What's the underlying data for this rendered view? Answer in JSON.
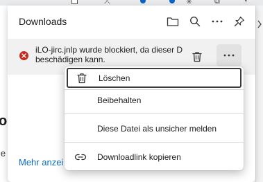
{
  "panel": {
    "title": "Downloads",
    "header_icons": [
      "folder-icon",
      "search-icon",
      "more-icon",
      "pin-icon"
    ]
  },
  "download_item": {
    "status_icon": "error-icon",
    "line1": "iLO-jirc.jnlp wurde blockiert, da dieser D",
    "line2": "beschädigen kann."
  },
  "more_link": "Mehr anzei",
  "background": {
    "fragment_letter": "o",
    "fragment_text": "ie"
  },
  "context_menu": {
    "items": [
      {
        "label": "Löschen",
        "icon": "trash-icon"
      },
      {
        "label": "Beibehalten",
        "icon": ""
      },
      {
        "label": "Diese Datei als unsicher melden",
        "icon": ""
      },
      {
        "label": "Downloadlink kopieren",
        "icon": "link-icon"
      }
    ]
  },
  "colors": {
    "accent": "#0f6cbd",
    "error": "#c42b1c",
    "item_background": "#f1f1f1"
  }
}
